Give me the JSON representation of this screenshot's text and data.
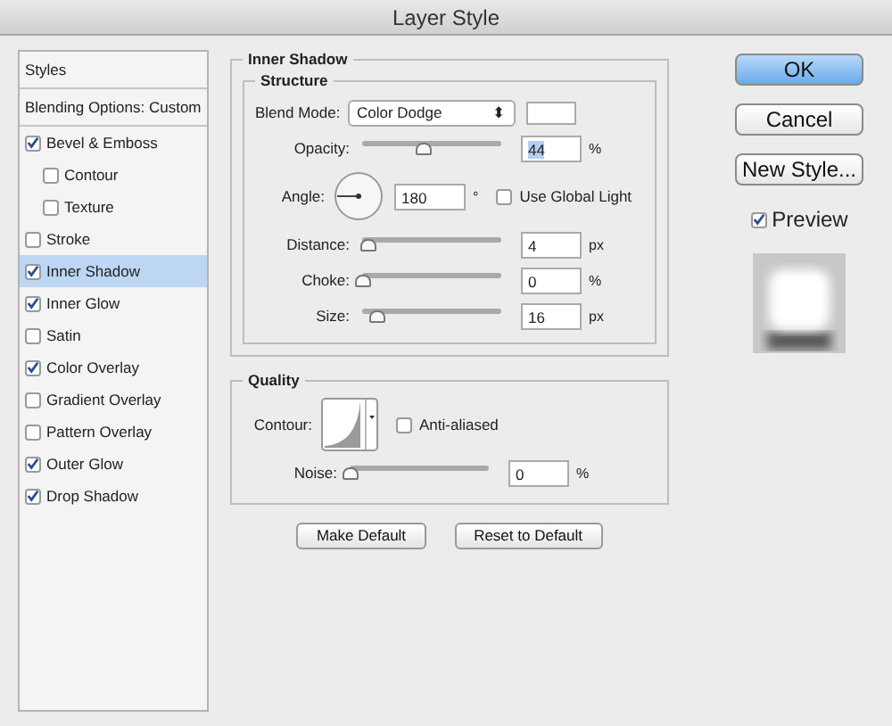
{
  "window": {
    "title": "Layer Style"
  },
  "sidebar": {
    "header": "Styles",
    "blending": "Blending Options: Custom",
    "items": [
      {
        "label": "Bevel & Emboss",
        "checked": true,
        "selected": false,
        "children": [
          {
            "label": "Contour",
            "checked": false,
            "selected": false
          },
          {
            "label": "Texture",
            "checked": false,
            "selected": false
          }
        ]
      },
      {
        "label": "Stroke",
        "checked": false,
        "selected": false
      },
      {
        "label": "Inner Shadow",
        "checked": true,
        "selected": true
      },
      {
        "label": "Inner Glow",
        "checked": true,
        "selected": false
      },
      {
        "label": "Satin",
        "checked": false,
        "selected": false
      },
      {
        "label": "Color Overlay",
        "checked": true,
        "selected": false
      },
      {
        "label": "Gradient Overlay",
        "checked": false,
        "selected": false
      },
      {
        "label": "Pattern Overlay",
        "checked": false,
        "selected": false
      },
      {
        "label": "Outer Glow",
        "checked": true,
        "selected": false
      },
      {
        "label": "Drop Shadow",
        "checked": true,
        "selected": false
      }
    ]
  },
  "panel": {
    "title": "Inner Shadow",
    "structure": {
      "title": "Structure",
      "blend_mode": {
        "label": "Blend Mode:",
        "value": "Color Dodge",
        "arrow": "⬍"
      },
      "rows": [
        {
          "kind": "slider",
          "label": "Opacity:",
          "level": 0.44,
          "value": "44",
          "unit": "%",
          "highlighted": true
        },
        {
          "kind": "angle",
          "label": "Angle:",
          "value": "180",
          "unit": "°",
          "checkbox": {
            "label": "Use Global Light",
            "checked": false
          }
        },
        {
          "kind": "slider",
          "label": "Distance:",
          "level": 0.04,
          "value": "4",
          "unit": "px",
          "highlighted": false
        },
        {
          "kind": "slider",
          "label": "Choke:",
          "level": 0,
          "value": "0",
          "unit": "%",
          "highlighted": false
        },
        {
          "kind": "slider",
          "label": "Size:",
          "level": 0.1,
          "value": "16",
          "unit": "px",
          "highlighted": false
        }
      ]
    },
    "quality": {
      "title": "Quality",
      "contour_label": "Contour:",
      "antialiased": {
        "label": "Anti-aliased",
        "checked": false
      },
      "noise": {
        "label": "Noise:",
        "level": 0,
        "value": "0",
        "unit": "%"
      }
    },
    "buttons": [
      "Make Default",
      "Reset to Default"
    ]
  },
  "actions": {
    "ok": "OK",
    "cancel": "Cancel",
    "new_style": "New Style...",
    "preview": {
      "label": "Preview",
      "checked": true
    }
  }
}
